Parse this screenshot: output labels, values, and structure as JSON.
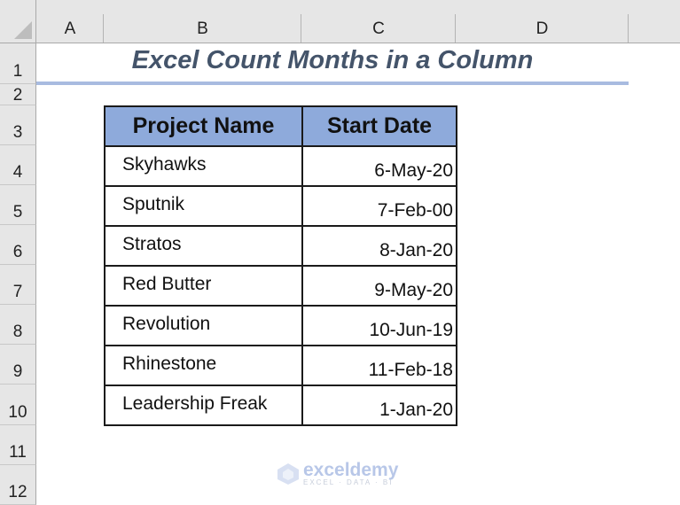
{
  "sheet": {
    "columns": [
      "A",
      "B",
      "C",
      "D"
    ],
    "rows": [
      "1",
      "2",
      "3",
      "4",
      "5",
      "6",
      "7",
      "8",
      "9",
      "10",
      "11",
      "12"
    ],
    "title": "Excel Count Months in a Column",
    "table": {
      "headers": [
        "Project Name",
        "Start Date"
      ],
      "rows": [
        [
          "Skyhawks",
          "6-May-20"
        ],
        [
          "Sputnik",
          "7-Feb-00"
        ],
        [
          "Stratos",
          "8-Jan-20"
        ],
        [
          "Red Butter",
          "9-May-20"
        ],
        [
          "Revolution",
          "10-Jun-19"
        ],
        [
          "Rhinestone",
          "11-Feb-18"
        ],
        [
          "Leadership Freak",
          "1-Jan-20"
        ]
      ]
    },
    "colors": {
      "header_fill": "#8eaadb",
      "title": "#44546a",
      "title_underline": "#a8bbe0"
    }
  },
  "watermark": {
    "name": "exceldemy",
    "tagline": "EXCEL · DATA · BI"
  }
}
